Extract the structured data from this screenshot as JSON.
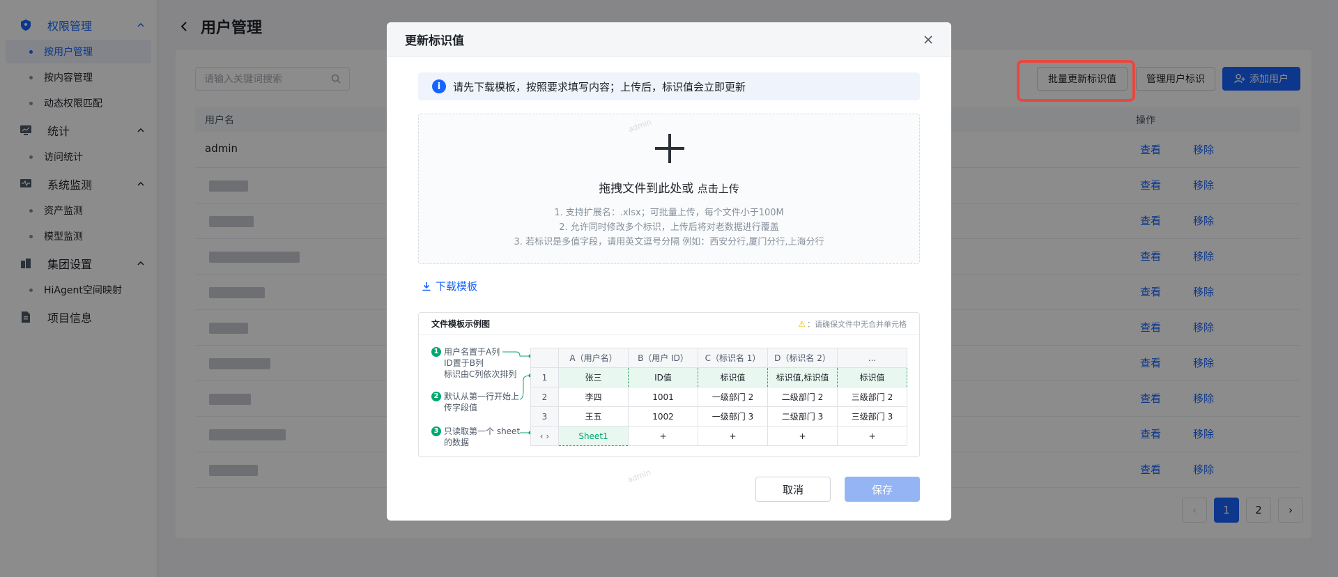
{
  "sidebar": {
    "groups": [
      {
        "label": "权限管理",
        "items": [
          "按用户管理",
          "按内容管理",
          "动态权限匹配"
        ]
      },
      {
        "label": "统计",
        "items": [
          "访问统计"
        ]
      },
      {
        "label": "系统监测",
        "items": [
          "资产监测",
          "模型监测"
        ]
      },
      {
        "label": "集团设置",
        "items": [
          "HiAgent空间映射"
        ]
      },
      {
        "label": "项目信息",
        "items": []
      }
    ]
  },
  "page": {
    "title": "用户管理",
    "search_placeholder": "请输入关键词搜索",
    "buttons": {
      "batch": "批量更新标识值",
      "manage": "管理用户标识",
      "add": "添加用户"
    },
    "table": {
      "col_user": "用户名",
      "col_action": "操作",
      "rows": [
        "admin",
        "",
        "",
        "",
        "",
        "",
        "",
        "",
        "",
        ""
      ],
      "view": "查看",
      "remove": "移除"
    },
    "pagination": {
      "prev": "‹",
      "next": "›",
      "pages": [
        "1",
        "2"
      ]
    }
  },
  "modal": {
    "title": "更新标识值",
    "info": "请先下载模板，按照要求填写内容；上传后，标识值会立即更新",
    "upload": {
      "title_prefix": "拖拽文件到此处或",
      "title_link": "点击上传",
      "tips": [
        "1. 支持扩展名：.xlsx；可批量上传，每个文件小于100M",
        "2. 允许同时修改多个标识，上传后将对老数据进行覆盖",
        "3. 若标识是多值字段，请用英文逗号分隔 例如：西安分行,厦门分行,上海分行"
      ]
    },
    "download": "下载模板",
    "example": {
      "title": "文件模板示例图",
      "warning": "请确保文件中无合并单元格",
      "notes": [
        {
          "num": "1",
          "lines": [
            "用户名置于A列",
            "ID置于B列",
            "标识由C列依次排列"
          ]
        },
        {
          "num": "2",
          "lines": [
            "默认从第一行开始上",
            "传字段值"
          ]
        },
        {
          "num": "3",
          "lines": [
            "只读取第一个 sheet",
            "的数据"
          ]
        }
      ],
      "header": [
        "A（用户名）",
        "B（用户 ID）",
        "C（标识名 1）",
        "D（标识名 2）",
        "..."
      ],
      "rows": [
        {
          "idx": "1",
          "cells": [
            "张三",
            "ID值",
            "标识值",
            "标识值,标识值",
            "标识值"
          ]
        },
        {
          "idx": "2",
          "cells": [
            "李四",
            "1001",
            "一级部门 2",
            "二级部门 2",
            "三级部门 2"
          ]
        },
        {
          "idx": "3",
          "cells": [
            "王五",
            "1002",
            "一级部门 3",
            "二级部门 3",
            "三级部门 3"
          ]
        }
      ],
      "sheet_row": {
        "idx": "‹ ›",
        "cells": [
          "Sheet1",
          "+",
          "+",
          "+",
          "+"
        ]
      }
    },
    "cancel": "取消",
    "save": "保存",
    "watermark": "admin"
  }
}
